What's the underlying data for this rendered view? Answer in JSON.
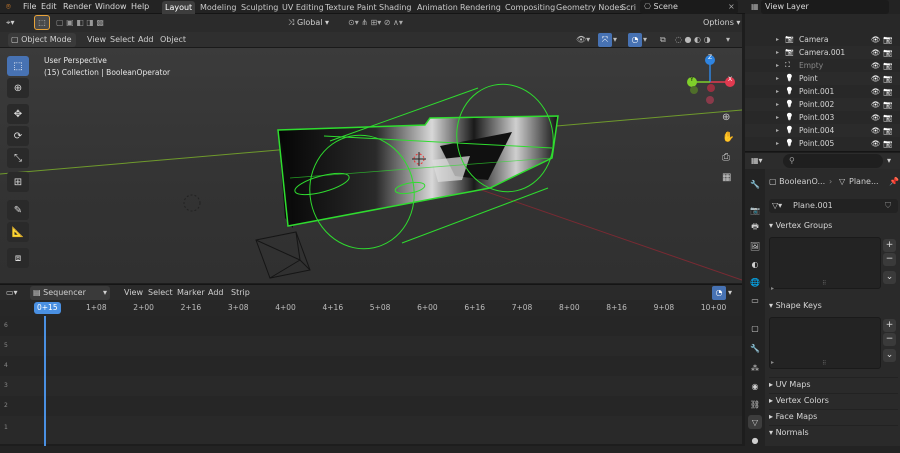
{
  "menubar": {
    "items": [
      "File",
      "Edit",
      "Render",
      "Window",
      "Help"
    ],
    "workspaces": [
      "Layout",
      "Modeling",
      "Sculpting",
      "UV Editing",
      "Texture Paint",
      "Shading",
      "Animation",
      "Rendering",
      "Compositing",
      "Geometry Nodes",
      "Scri"
    ],
    "active_workspace": "Layout",
    "scene": "Scene",
    "view_layer": "View Layer"
  },
  "viewport": {
    "transform_orientation": "Global",
    "options_label": "Options",
    "mode": "Object Mode",
    "menus": [
      "View",
      "Select",
      "Add",
      "Object"
    ],
    "perspective_label": "User Perspective",
    "collection_label": "(15) Collection | BooleanOperator",
    "gizmo": {
      "x": "X",
      "y": "Y",
      "z": "Z"
    }
  },
  "sequencer": {
    "editor_name": "Sequencer",
    "menus": [
      "View",
      "Select",
      "Marker",
      "Add",
      "Strip"
    ],
    "current_frame": "0+15",
    "ticks": [
      "1+08",
      "2+00",
      "2+16",
      "3+08",
      "4+00",
      "4+16",
      "5+08",
      "6+00",
      "6+16",
      "7+08",
      "8+00",
      "8+16",
      "9+08",
      "10+00"
    ],
    "channels": [
      "6",
      "5",
      "4",
      "3",
      "2",
      "1"
    ]
  },
  "outliner": {
    "items": [
      {
        "name": "Camera",
        "icon": "camera-icon"
      },
      {
        "name": "Camera.001",
        "icon": "camera-icon"
      },
      {
        "name": "Empty",
        "icon": "empty-icon"
      },
      {
        "name": "Point",
        "icon": "light-icon"
      },
      {
        "name": "Point.001",
        "icon": "light-icon"
      },
      {
        "name": "Point.002",
        "icon": "light-icon"
      },
      {
        "name": "Point.003",
        "icon": "light-icon"
      },
      {
        "name": "Point.004",
        "icon": "light-icon"
      },
      {
        "name": "Point.005",
        "icon": "light-icon"
      }
    ]
  },
  "properties": {
    "object_name": "BooleanO...",
    "data_name": "Plane...",
    "mesh_name": "Plane.001",
    "sections": {
      "vertex_groups": "Vertex Groups",
      "shape_keys": "Shape Keys",
      "uv_maps": "UV Maps",
      "vertex_colors": "Vertex Colors",
      "face_maps": "Face Maps",
      "normals": "Normals"
    }
  },
  "colors": {
    "accent": "#4772b3",
    "selection_outline": "#2fdc2f",
    "playhead": "#4a90e2",
    "x_axis": "#e23a50",
    "y_axis": "#7fcf2a",
    "z_axis": "#2f84e0"
  }
}
